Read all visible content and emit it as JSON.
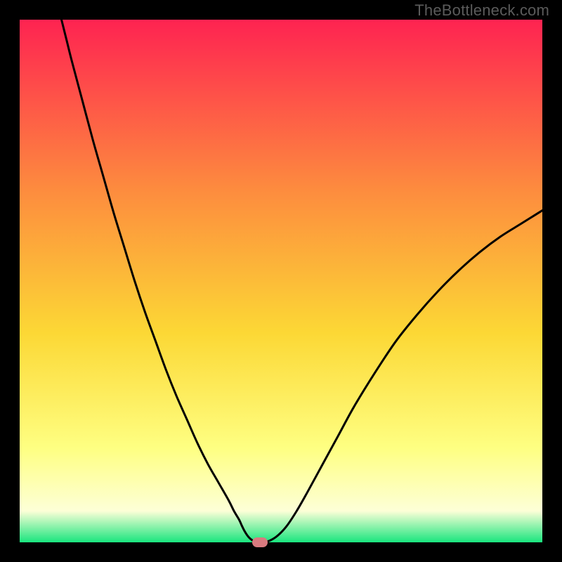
{
  "watermark": "TheBottleneck.com",
  "colors": {
    "frame": "#000000",
    "watermark": "#5b5b5b",
    "gradient_top": "#fe2351",
    "gradient_mid_upper": "#fd8d3e",
    "gradient_mid": "#fcd835",
    "gradient_mid_lower": "#feff82",
    "gradient_lower": "#fdffd7",
    "gradient_bottom": "#19e57e",
    "curve": "#000000",
    "marker": "#d97a7f"
  },
  "chart_data": {
    "type": "line",
    "title": "",
    "xlabel": "",
    "ylabel": "",
    "xlim": [
      0,
      100
    ],
    "ylim": [
      0,
      100
    ],
    "grid": false,
    "legend": false,
    "x": [
      8,
      9,
      10,
      12,
      14,
      16,
      18,
      20,
      22,
      24,
      26,
      28,
      30,
      32,
      34,
      36,
      38,
      40,
      41,
      42,
      42.5,
      43,
      43.5,
      44,
      44.5,
      45,
      46,
      47,
      49,
      51,
      53,
      55,
      58,
      61,
      64,
      68,
      72,
      76,
      80,
      84,
      88,
      92,
      96,
      100
    ],
    "values": [
      100,
      96,
      92,
      84.5,
      77,
      70,
      63,
      56.5,
      50,
      44,
      38.5,
      33,
      28,
      23.5,
      19,
      15,
      11.5,
      8,
      6,
      4.3,
      3.2,
      2.2,
      1.4,
      0.8,
      0.4,
      0.1,
      0,
      0,
      1,
      3,
      6,
      9.5,
      15,
      20.5,
      26,
      32.5,
      38.5,
      43.5,
      48,
      52,
      55.5,
      58.5,
      61,
      63.5
    ],
    "marker": {
      "x": 46,
      "y": 0
    },
    "annotations": []
  }
}
